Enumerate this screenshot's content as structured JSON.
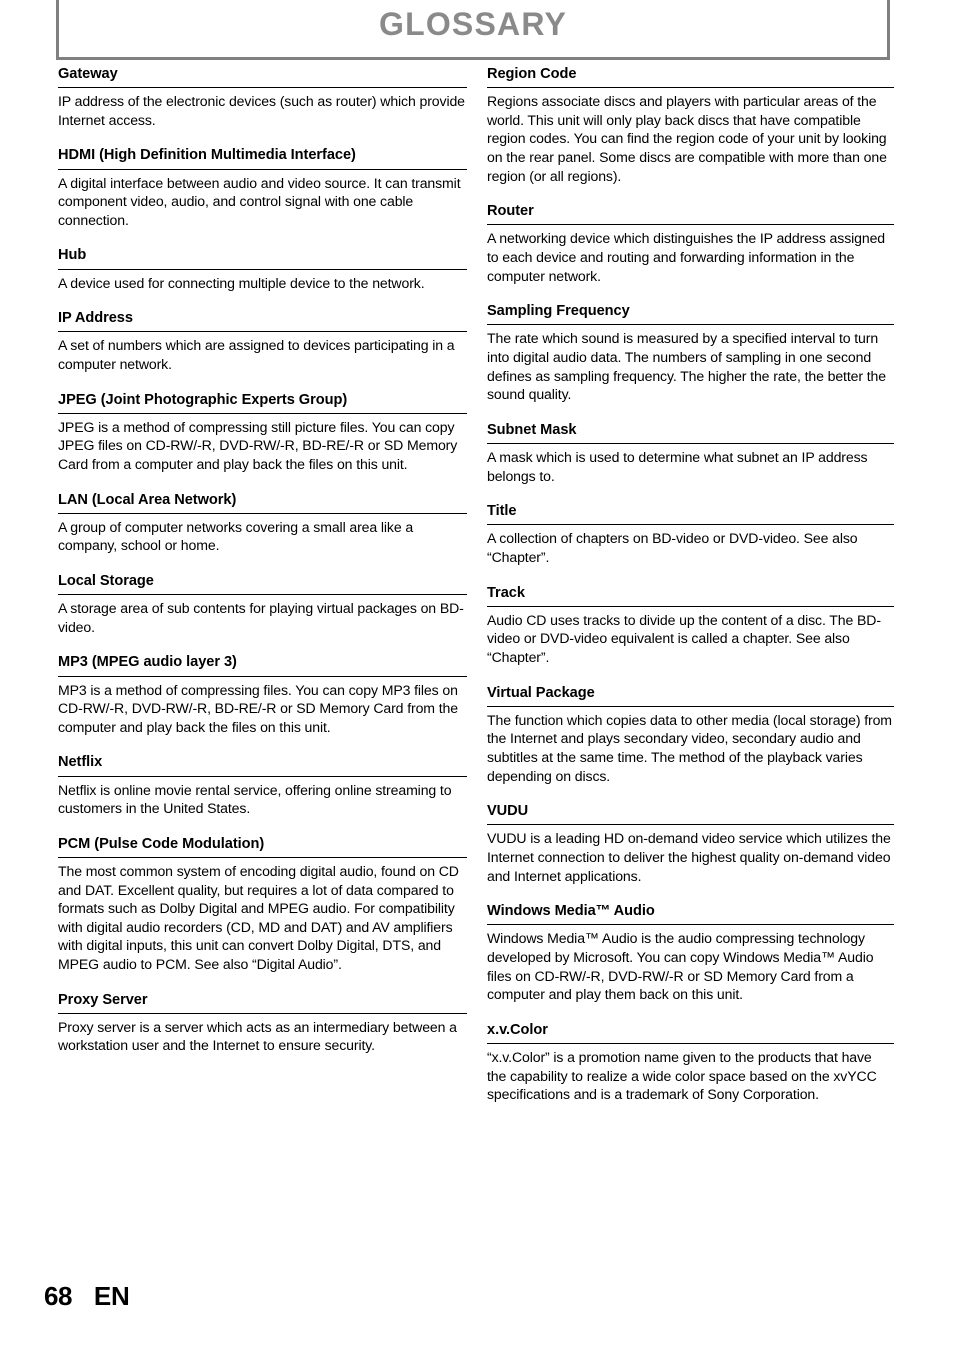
{
  "header": {
    "title": "GLOSSARY",
    "border_color": "#808080",
    "title_color": "#8a8a8a"
  },
  "footer": {
    "page_number": "68",
    "language": "EN"
  },
  "columns": {
    "left": [
      {
        "term": "Gateway",
        "definition": "IP address of the electronic devices (such as router) which provide Internet access."
      },
      {
        "term": "HDMI (High Definition Multimedia Interface)",
        "definition": "A digital interface between audio and video source. It can transmit component video, audio, and control signal with one cable connection."
      },
      {
        "term": "Hub",
        "definition": "A device used for connecting multiple device to the network."
      },
      {
        "term": "IP Address",
        "definition": "A set of numbers which are assigned to devices participating in a computer network."
      },
      {
        "term": "JPEG (Joint Photographic Experts Group)",
        "definition": "JPEG is a method of compressing still picture files. You can copy JPEG files on CD-RW/-R, DVD-RW/-R, BD-RE/-R or SD Memory Card from a computer and play back the files on this unit."
      },
      {
        "term": "LAN (Local Area Network)",
        "definition": "A group of computer networks covering a small area like a company, school or home."
      },
      {
        "term": "Local Storage",
        "definition": "A storage area of sub contents for playing virtual packages on BD-video."
      },
      {
        "term": "MP3 (MPEG audio layer 3)",
        "definition": "MP3 is a method of compressing files. You can copy MP3 files on CD-RW/-R, DVD-RW/-R, BD-RE/-R or SD Memory Card from the computer and play back the files on this unit."
      },
      {
        "term": "Netflix",
        "definition": "Netflix is online movie rental service, offering online streaming to customers in the United States."
      },
      {
        "term": "PCM (Pulse Code Modulation)",
        "definition": "The most common system of encoding digital audio, found on CD and DAT. Excellent quality, but requires a lot of data compared to formats such as Dolby Digital and MPEG audio. For compatibility with digital audio recorders (CD, MD and DAT) and AV amplifiers with digital inputs, this unit can convert Dolby Digital, DTS, and MPEG audio to PCM. See also “Digital Audio”."
      },
      {
        "term": "Proxy Server",
        "definition": "Proxy server is a server which acts as an intermediary between a workstation user and the Internet to ensure security."
      }
    ],
    "right": [
      {
        "term": "Region Code",
        "definition": "Regions associate discs and players with particular areas of the world. This unit will only play back discs that have compatible region codes. You can find the region code of your unit by looking on the rear panel. Some discs are compatible with more than one region (or all regions)."
      },
      {
        "term": "Router",
        "definition": "A networking device which distinguishes the IP address assigned to each device and routing and forwarding information in the computer network."
      },
      {
        "term": "Sampling Frequency",
        "definition": "The rate which sound is measured by a specified interval to turn into digital audio data. The numbers of sampling in one second defines as sampling frequency. The higher the rate, the better the sound quality."
      },
      {
        "term": "Subnet Mask",
        "definition": "A mask which is used to determine what subnet an IP address belongs to."
      },
      {
        "term": "Title",
        "definition": "A collection of chapters on BD-video or DVD-video. See also “Chapter”."
      },
      {
        "term": "Track",
        "definition": "Audio CD uses tracks to divide up the content of a disc. The BD-video or DVD-video equivalent is called a chapter. See also “Chapter”."
      },
      {
        "term": "Virtual Package",
        "definition": "The function which copies data to other media (local storage) from the Internet and plays secondary video, secondary audio and subtitles at the same time. The method of the playback varies depending on discs."
      },
      {
        "term": "VUDU",
        "definition": "VUDU is a leading HD on-demand video service which utilizes the Internet connection to deliver the highest quality on-demand video and Internet applications."
      },
      {
        "term": "Windows Media™ Audio",
        "definition": "Windows Media™ Audio is the audio compressing technology developed by Microsoft. You can copy Windows Media™ Audio files on CD-RW/-R, DVD-RW/-R or SD Memory Card from a computer and play them back on this unit."
      },
      {
        "term": "x.v.Color",
        "definition": "“x.v.Color” is a promotion name given to the products that have the capability to realize a wide color space based on the xvYCC specifications and is a trademark of Sony Corporation."
      }
    ]
  }
}
